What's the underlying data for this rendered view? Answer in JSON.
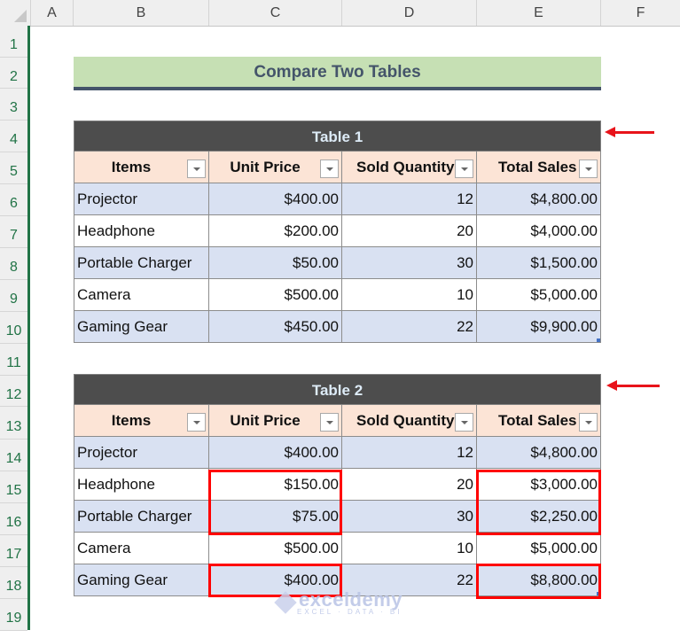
{
  "sheet": {
    "columns": [
      "A",
      "B",
      "C",
      "D",
      "E",
      "F"
    ],
    "rows": [
      "1",
      "2",
      "3",
      "4",
      "5",
      "6",
      "7",
      "8",
      "9",
      "10",
      "11",
      "12",
      "13",
      "14",
      "15",
      "16",
      "17",
      "18",
      "19"
    ]
  },
  "banner": {
    "title": "Compare Two Tables"
  },
  "table1": {
    "title": "Table 1",
    "headers": [
      "Items",
      "Unit Price",
      "Sold Quantity",
      "Total Sales"
    ],
    "rows": [
      [
        "Projector",
        "$400.00",
        "12",
        "$4,800.00"
      ],
      [
        "Headphone",
        "$200.00",
        "20",
        "$4,000.00"
      ],
      [
        "Portable Charger",
        "$50.00",
        "30",
        "$1,500.00"
      ],
      [
        "Camera",
        "$500.00",
        "10",
        "$5,000.00"
      ],
      [
        "Gaming Gear",
        "$450.00",
        "22",
        "$9,900.00"
      ]
    ]
  },
  "table2": {
    "title": "Table 2",
    "headers": [
      "Items",
      "Unit Price",
      "Sold Quantity",
      "Total Sales"
    ],
    "rows": [
      [
        "Projector",
        "$400.00",
        "12",
        "$4,800.00"
      ],
      [
        "Headphone",
        "$150.00",
        "20",
        "$3,000.00"
      ],
      [
        "Portable Charger",
        "$75.00",
        "30",
        "$2,250.00"
      ],
      [
        "Camera",
        "$500.00",
        "10",
        "$5,000.00"
      ],
      [
        "Gaming Gear",
        "$400.00",
        "22",
        "$8,800.00"
      ]
    ]
  },
  "watermark": {
    "name": "exceldemy",
    "tagline": "EXCEL · DATA · BI"
  },
  "colors": {
    "highlight": "#ff0000",
    "arrow": "#e8131a",
    "banner_bg": "#c6e0b4",
    "title_bar": "#4d4d4d",
    "header_bg": "#fce4d6",
    "band_bg": "#d9e1f2"
  }
}
